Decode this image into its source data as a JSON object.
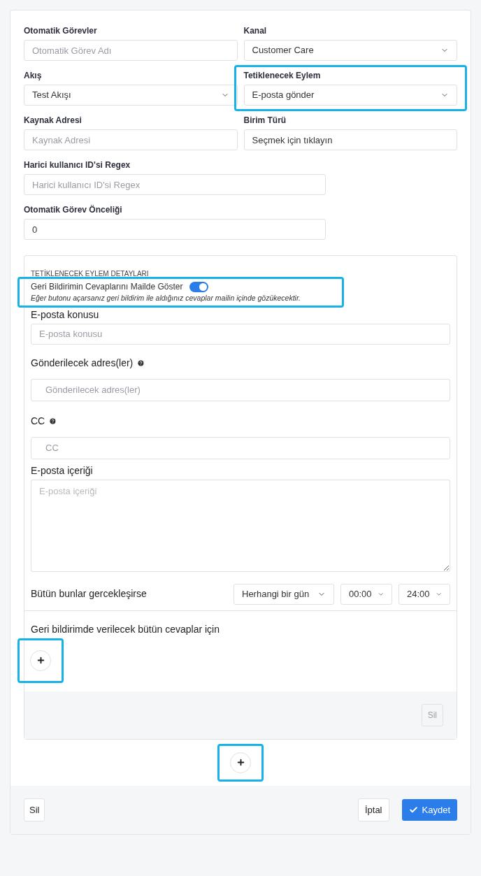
{
  "fields": [
    {
      "label": "Otomatik Görevler",
      "kind": "input",
      "placeholder": "Otomatik Görev Adı",
      "highlighted": false
    },
    {
      "label": "Kanal",
      "kind": "select",
      "value": "Customer Care",
      "highlighted": false
    },
    {
      "label": "Akış",
      "kind": "select",
      "value": "Test Akışı",
      "highlighted": false
    },
    {
      "label": "Tetiklenecek Eylem",
      "kind": "select",
      "value": "E-posta gönder",
      "highlighted": true
    },
    {
      "label": "Kaynak Adresi",
      "kind": "input",
      "placeholder": "Kaynak Adresi",
      "highlighted": false
    },
    {
      "label": "Birim Türü",
      "kind": "input",
      "value": "Seçmek için tıklayın",
      "highlighted": false
    }
  ],
  "wide_fields": [
    {
      "label": "Harici kullanıcı ID'si Regex",
      "placeholder": "Harici kullanıcı ID'si Regex"
    },
    {
      "label": "Otomatik Görev Önceliği",
      "value": "0"
    }
  ],
  "details": {
    "heading": "TETİKLENECEK EYLEM DETAYLARI",
    "toggle": {
      "label": "Geri Bildirimin Cevaplarını Mailde Göster",
      "on": true,
      "hint": "Eğer butonu açarsanız geri bildirim ile aldığınız cevaplar mailin içinde gözükecektir.",
      "highlighted": true
    },
    "subject": {
      "label": "E-posta konusu",
      "placeholder": "E-posta konusu"
    },
    "recipients": {
      "label": "Gönderilecek adres(ler)",
      "placeholder": "Gönderilecek adres(ler)"
    },
    "cc": {
      "label": "CC",
      "placeholder": "CC"
    },
    "body": {
      "label": "E-posta içeriği",
      "placeholder": "E-posta içeriği"
    },
    "condition": {
      "label": "Bütün bunlar gercekleşirse",
      "day": "Herhangi bir gün",
      "start": "00:00",
      "end": "24:00"
    },
    "answers": {
      "label": "Geri bildirimde verilecek bütün cevaplar için",
      "add_highlighted": true
    },
    "delete": {
      "label": "Sil",
      "disabled": true
    }
  },
  "add_highlighted": true,
  "footer": {
    "delete": "Sil",
    "cancel": "İptal",
    "save": "Kaydet"
  }
}
